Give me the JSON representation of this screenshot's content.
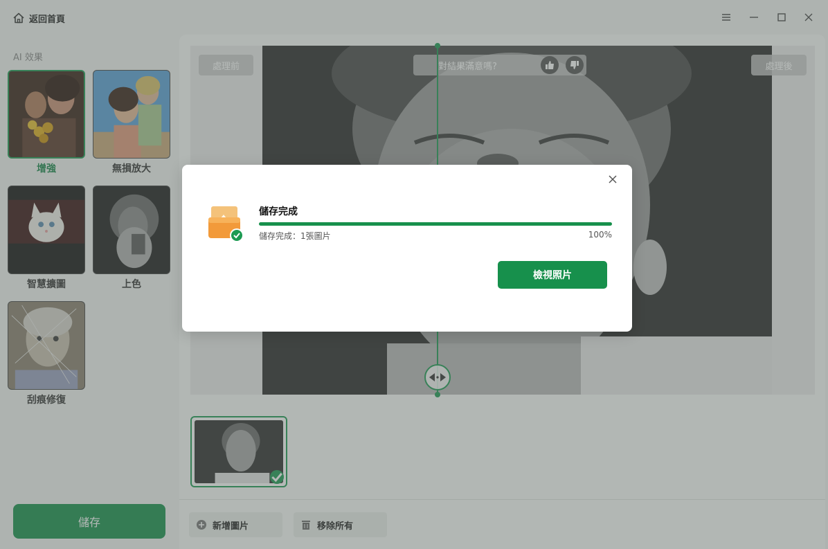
{
  "titlebar": {
    "home_label": "返回首頁"
  },
  "sidebar": {
    "section_title": "AI 效果",
    "effects": [
      {
        "label": "增強",
        "active": true
      },
      {
        "label": "無損放大",
        "active": false
      },
      {
        "label": "智慧擴圖",
        "active": false
      },
      {
        "label": "上色",
        "active": false
      },
      {
        "label": "刮痕修復",
        "active": false
      }
    ],
    "save_label": "儲存"
  },
  "main": {
    "before_label": "處理前",
    "after_label": "處理後",
    "feedback_question": "對結果滿意嗎?",
    "add_image_label": "新增圖片",
    "remove_all_label": "移除所有"
  },
  "dialog": {
    "title": "儲存完成",
    "status": "儲存完成：1張圖片",
    "percent": "100%",
    "progress_fraction": 1.0,
    "view_button_label": "檢視照片"
  },
  "colors": {
    "accent": "#17904c",
    "overlay": "rgba(90,100,95,0.45)"
  }
}
